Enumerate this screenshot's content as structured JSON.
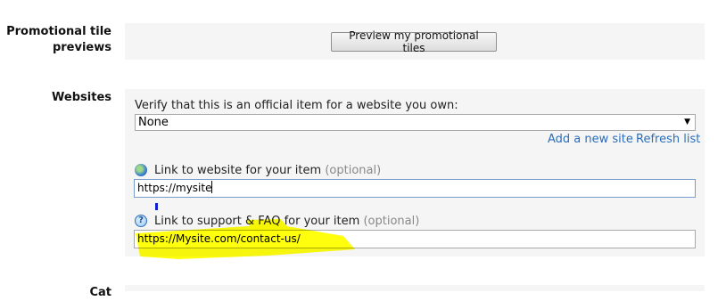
{
  "promo": {
    "label_line1": "Promotional tile",
    "label_line2": "previews",
    "button_label": "Preview my promotional tiles"
  },
  "websites": {
    "label": "Websites",
    "verify_text": "Verify that this is an official item for a website you own:",
    "selected_option": "None",
    "add_site_link": "Add a new site",
    "refresh_link": "Refresh list",
    "website_field": {
      "label": "Link to website for your item",
      "optional": "(optional)",
      "value": "https://mysite"
    },
    "support_field": {
      "label": "Link to support & FAQ for your item",
      "optional": "(optional)",
      "value": "https://Mysite.com/contact-us/"
    }
  },
  "next_section": {
    "label_partial": "Cat"
  },
  "colors": {
    "panel_bg": "#f5f5f5",
    "link": "#2a6ebb",
    "highlight": "#ffff00"
  },
  "icons": {
    "website": "globe-icon",
    "support": "help-icon",
    "select": "dropdown-arrow-icon"
  }
}
